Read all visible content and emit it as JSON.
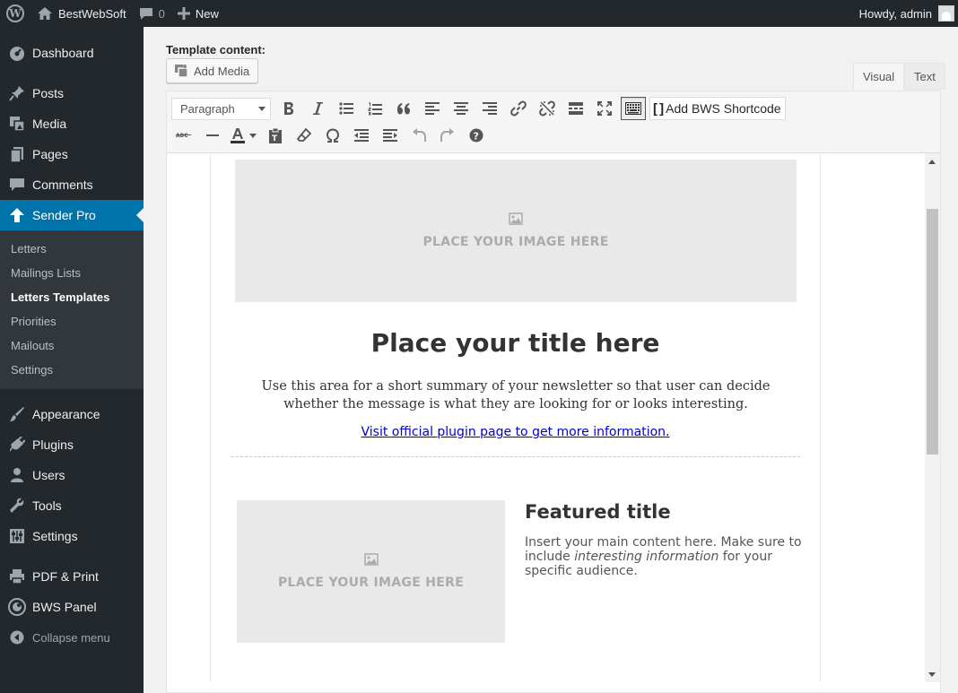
{
  "adminbar": {
    "site_name": "BestWebSoft",
    "comments_count": "0",
    "new_label": "New",
    "howdy": "Howdy, admin"
  },
  "sidebar": {
    "items": [
      {
        "label": "Dashboard",
        "icon": "dashboard-icon"
      },
      {
        "label": "Posts",
        "icon": "pin-icon"
      },
      {
        "label": "Media",
        "icon": "media-icon"
      },
      {
        "label": "Pages",
        "icon": "pages-icon"
      },
      {
        "label": "Comments",
        "icon": "comment-icon"
      },
      {
        "label": "Sender Pro",
        "icon": "arrow-up-icon",
        "current": true
      },
      {
        "label": "Appearance",
        "icon": "brush-icon"
      },
      {
        "label": "Plugins",
        "icon": "plug-icon"
      },
      {
        "label": "Users",
        "icon": "user-icon"
      },
      {
        "label": "Tools",
        "icon": "wrench-icon"
      },
      {
        "label": "Settings",
        "icon": "sliders-icon"
      },
      {
        "label": "PDF & Print",
        "icon": "printer-icon"
      },
      {
        "label": "BWS Panel",
        "icon": "bws-icon"
      }
    ],
    "submenu": [
      "Letters",
      "Mailings Lists",
      "Letters Templates",
      "Priorities",
      "Mailouts",
      "Settings"
    ],
    "submenu_current": "Letters Templates",
    "collapse_label": "Collapse menu"
  },
  "editor": {
    "label": "Template content:",
    "add_media": "Add Media",
    "tab_visual": "Visual",
    "tab_text": "Text",
    "format_select": "Paragraph",
    "shortcode_button": "Add BWS Shortcode",
    "color_swatch": "#333333"
  },
  "email": {
    "placeholder_big": "PLACE YOUR IMAGE HERE",
    "title": "Place your title here",
    "summary": "Use this area for a short summary of your newsletter so that user can decide whether the message is what they are looking for or looks interesting.",
    "link": "Visit official plugin page to get more information.",
    "placeholder_small": "PLACE YOUR IMAGE HERE",
    "featured_title": "Featured title",
    "featured_text_1": "Insert your main content here. Make sure to include ",
    "featured_text_em": "interesting information",
    "featured_text_2": " for your specific audience."
  }
}
